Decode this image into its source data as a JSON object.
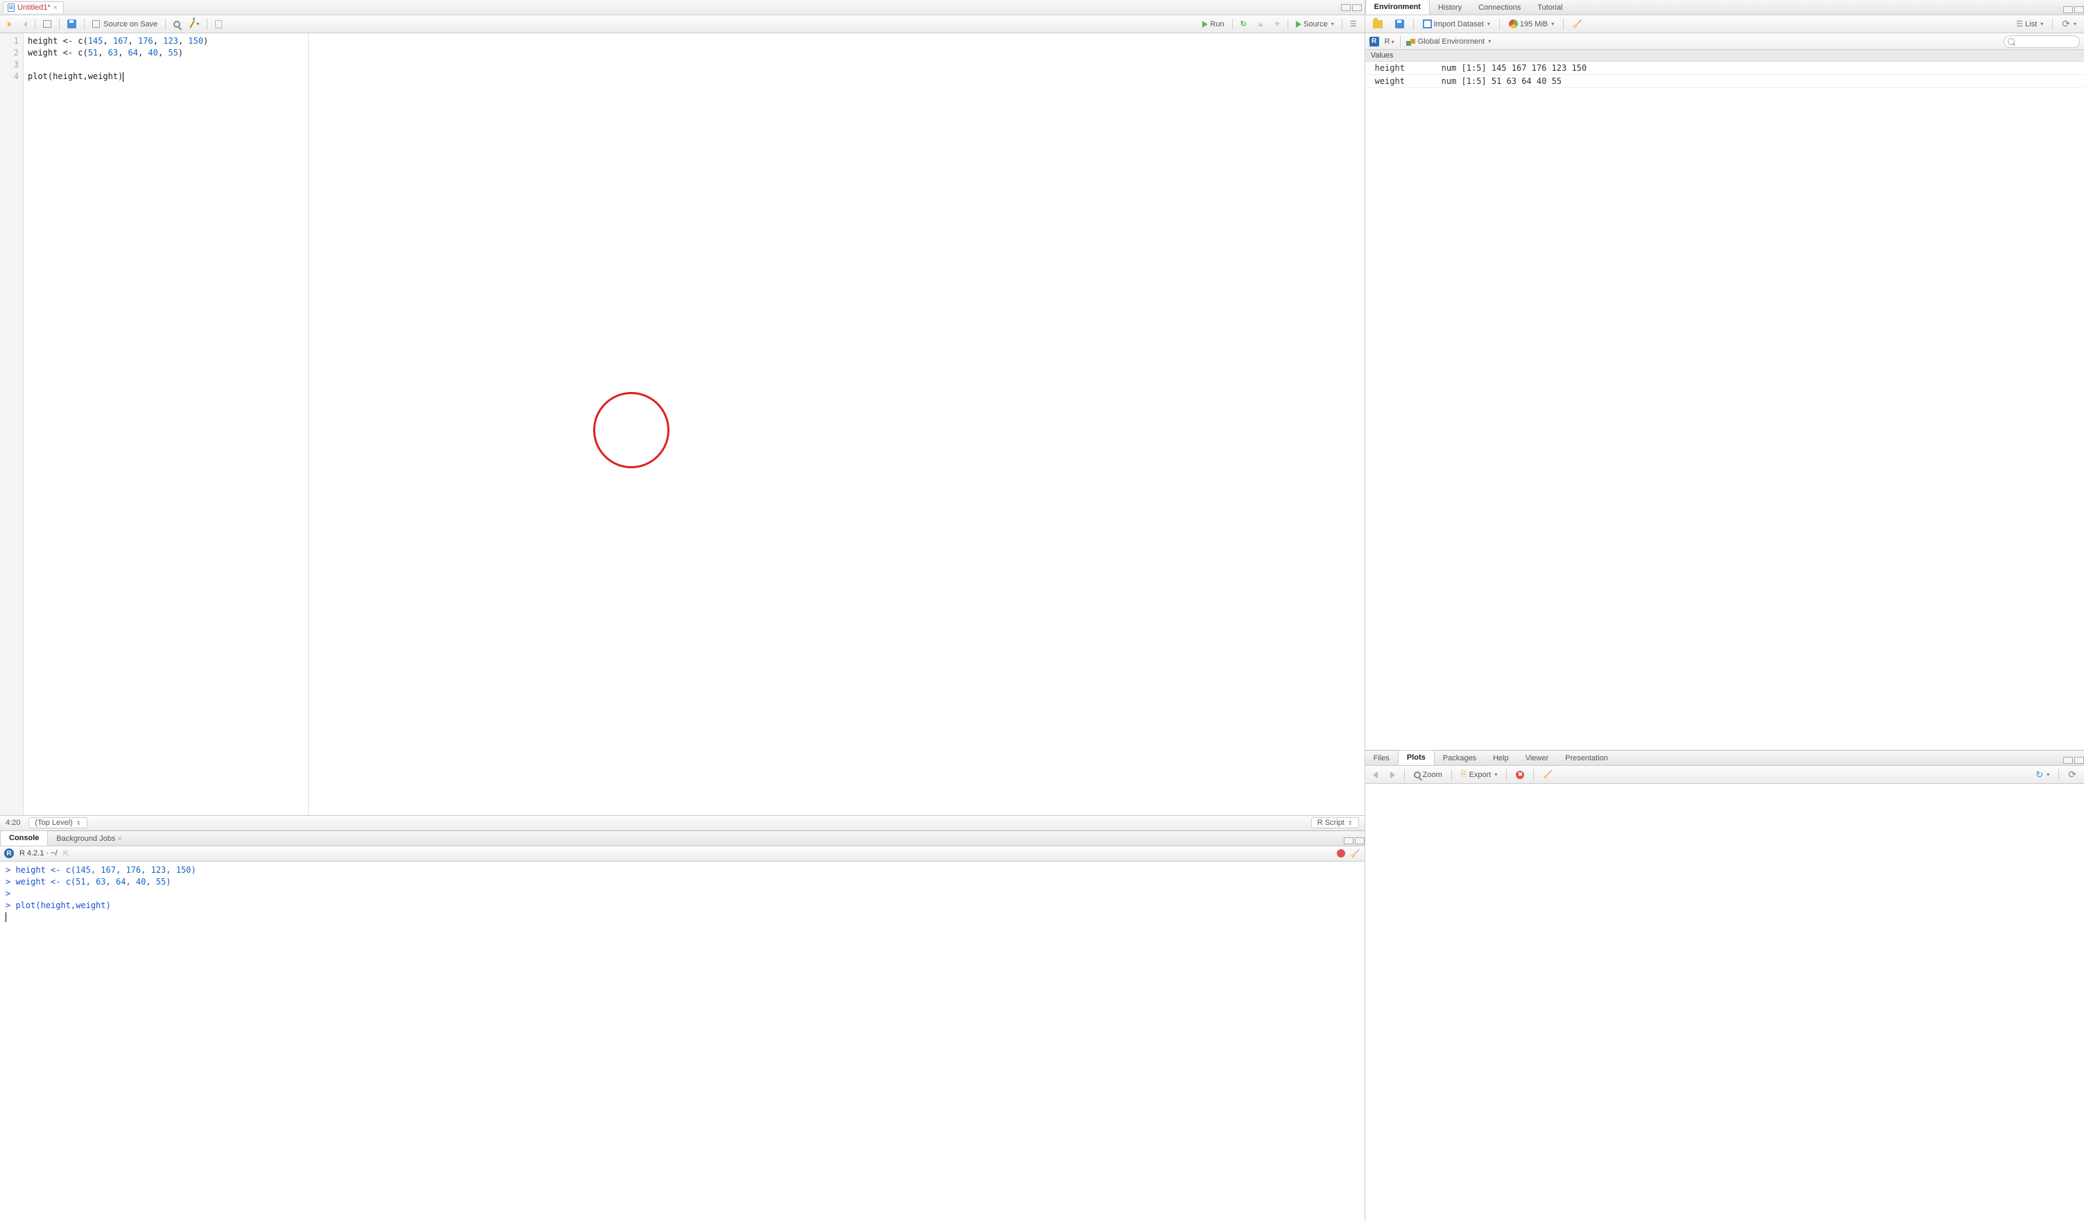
{
  "source": {
    "tab_title": "Untitled1*",
    "toolbar": {
      "source_on_save": "Source on Save",
      "run": "Run",
      "source": "Source"
    },
    "lines": [
      {
        "n": "1",
        "tokens": [
          {
            "t": "height <- c(",
            "c": "txt"
          },
          {
            "t": "145",
            "c": "num"
          },
          {
            "t": ", ",
            "c": "txt"
          },
          {
            "t": "167",
            "c": "num"
          },
          {
            "t": ", ",
            "c": "txt"
          },
          {
            "t": "176",
            "c": "num"
          },
          {
            "t": ", ",
            "c": "txt"
          },
          {
            "t": "123",
            "c": "num"
          },
          {
            "t": ", ",
            "c": "txt"
          },
          {
            "t": "150",
            "c": "num"
          },
          {
            "t": ")",
            "c": "txt"
          }
        ]
      },
      {
        "n": "2",
        "tokens": [
          {
            "t": "weight <- c(",
            "c": "txt"
          },
          {
            "t": "51",
            "c": "num"
          },
          {
            "t": ", ",
            "c": "txt"
          },
          {
            "t": "63",
            "c": "num"
          },
          {
            "t": ", ",
            "c": "txt"
          },
          {
            "t": "64",
            "c": "num"
          },
          {
            "t": ", ",
            "c": "txt"
          },
          {
            "t": "40",
            "c": "num"
          },
          {
            "t": ", ",
            "c": "txt"
          },
          {
            "t": "55",
            "c": "num"
          },
          {
            "t": ")",
            "c": "txt"
          }
        ]
      },
      {
        "n": "3",
        "tokens": []
      },
      {
        "n": "4",
        "tokens": [
          {
            "t": "plot(height,weight)",
            "c": "txt"
          }
        ],
        "caret": true
      }
    ],
    "status": {
      "pos": "4:20",
      "scope": "(Top Level)",
      "lang": "R Script"
    }
  },
  "console": {
    "tabs": {
      "console": "Console",
      "bg": "Background Jobs"
    },
    "head": "R 4.2.1 · ~/",
    "lines": [
      [
        {
          "t": "> ",
          "c": "pr"
        },
        {
          "t": "height <- c(",
          "c": "pr"
        },
        {
          "t": "145",
          "c": "pn"
        },
        {
          "t": ", ",
          "c": "pr"
        },
        {
          "t": "167",
          "c": "pn"
        },
        {
          "t": ", ",
          "c": "pr"
        },
        {
          "t": "176",
          "c": "pn"
        },
        {
          "t": ", ",
          "c": "pr"
        },
        {
          "t": "123",
          "c": "pn"
        },
        {
          "t": ", ",
          "c": "pr"
        },
        {
          "t": "150",
          "c": "pn"
        },
        {
          "t": ")",
          "c": "pr"
        }
      ],
      [
        {
          "t": "> ",
          "c": "pr"
        },
        {
          "t": "weight <- c(",
          "c": "pr"
        },
        {
          "t": "51",
          "c": "pn"
        },
        {
          "t": ", ",
          "c": "pr"
        },
        {
          "t": "63",
          "c": "pn"
        },
        {
          "t": ", ",
          "c": "pr"
        },
        {
          "t": "64",
          "c": "pn"
        },
        {
          "t": ", ",
          "c": "pr"
        },
        {
          "t": "40",
          "c": "pn"
        },
        {
          "t": ", ",
          "c": "pr"
        },
        {
          "t": "55",
          "c": "pn"
        },
        {
          "t": ")",
          "c": "pr"
        }
      ],
      [
        {
          "t": "> ",
          "c": "pr"
        }
      ],
      [
        {
          "t": "> ",
          "c": "pr"
        },
        {
          "t": "plot(height,weight)",
          "c": "pr"
        }
      ]
    ]
  },
  "environment": {
    "tabs": {
      "env": "Environment",
      "hist": "History",
      "conn": "Connections",
      "tut": "Tutorial"
    },
    "tools": {
      "import": "Import Dataset",
      "mem": "195 MiB",
      "list": "List"
    },
    "scope": {
      "lang": "R",
      "env": "Global Environment"
    },
    "section": "Values",
    "rows": [
      {
        "name": "height",
        "value": "num [1:5] 145 167 176 123 150"
      },
      {
        "name": "weight",
        "value": "num [1:5] 51 63 64 40 55"
      }
    ]
  },
  "plots": {
    "tabs": {
      "files": "Files",
      "plots": "Plots",
      "pkg": "Packages",
      "help": "Help",
      "viewer": "Viewer",
      "pres": "Presentation"
    },
    "tools": {
      "zoom": "Zoom",
      "export": "Export"
    }
  }
}
